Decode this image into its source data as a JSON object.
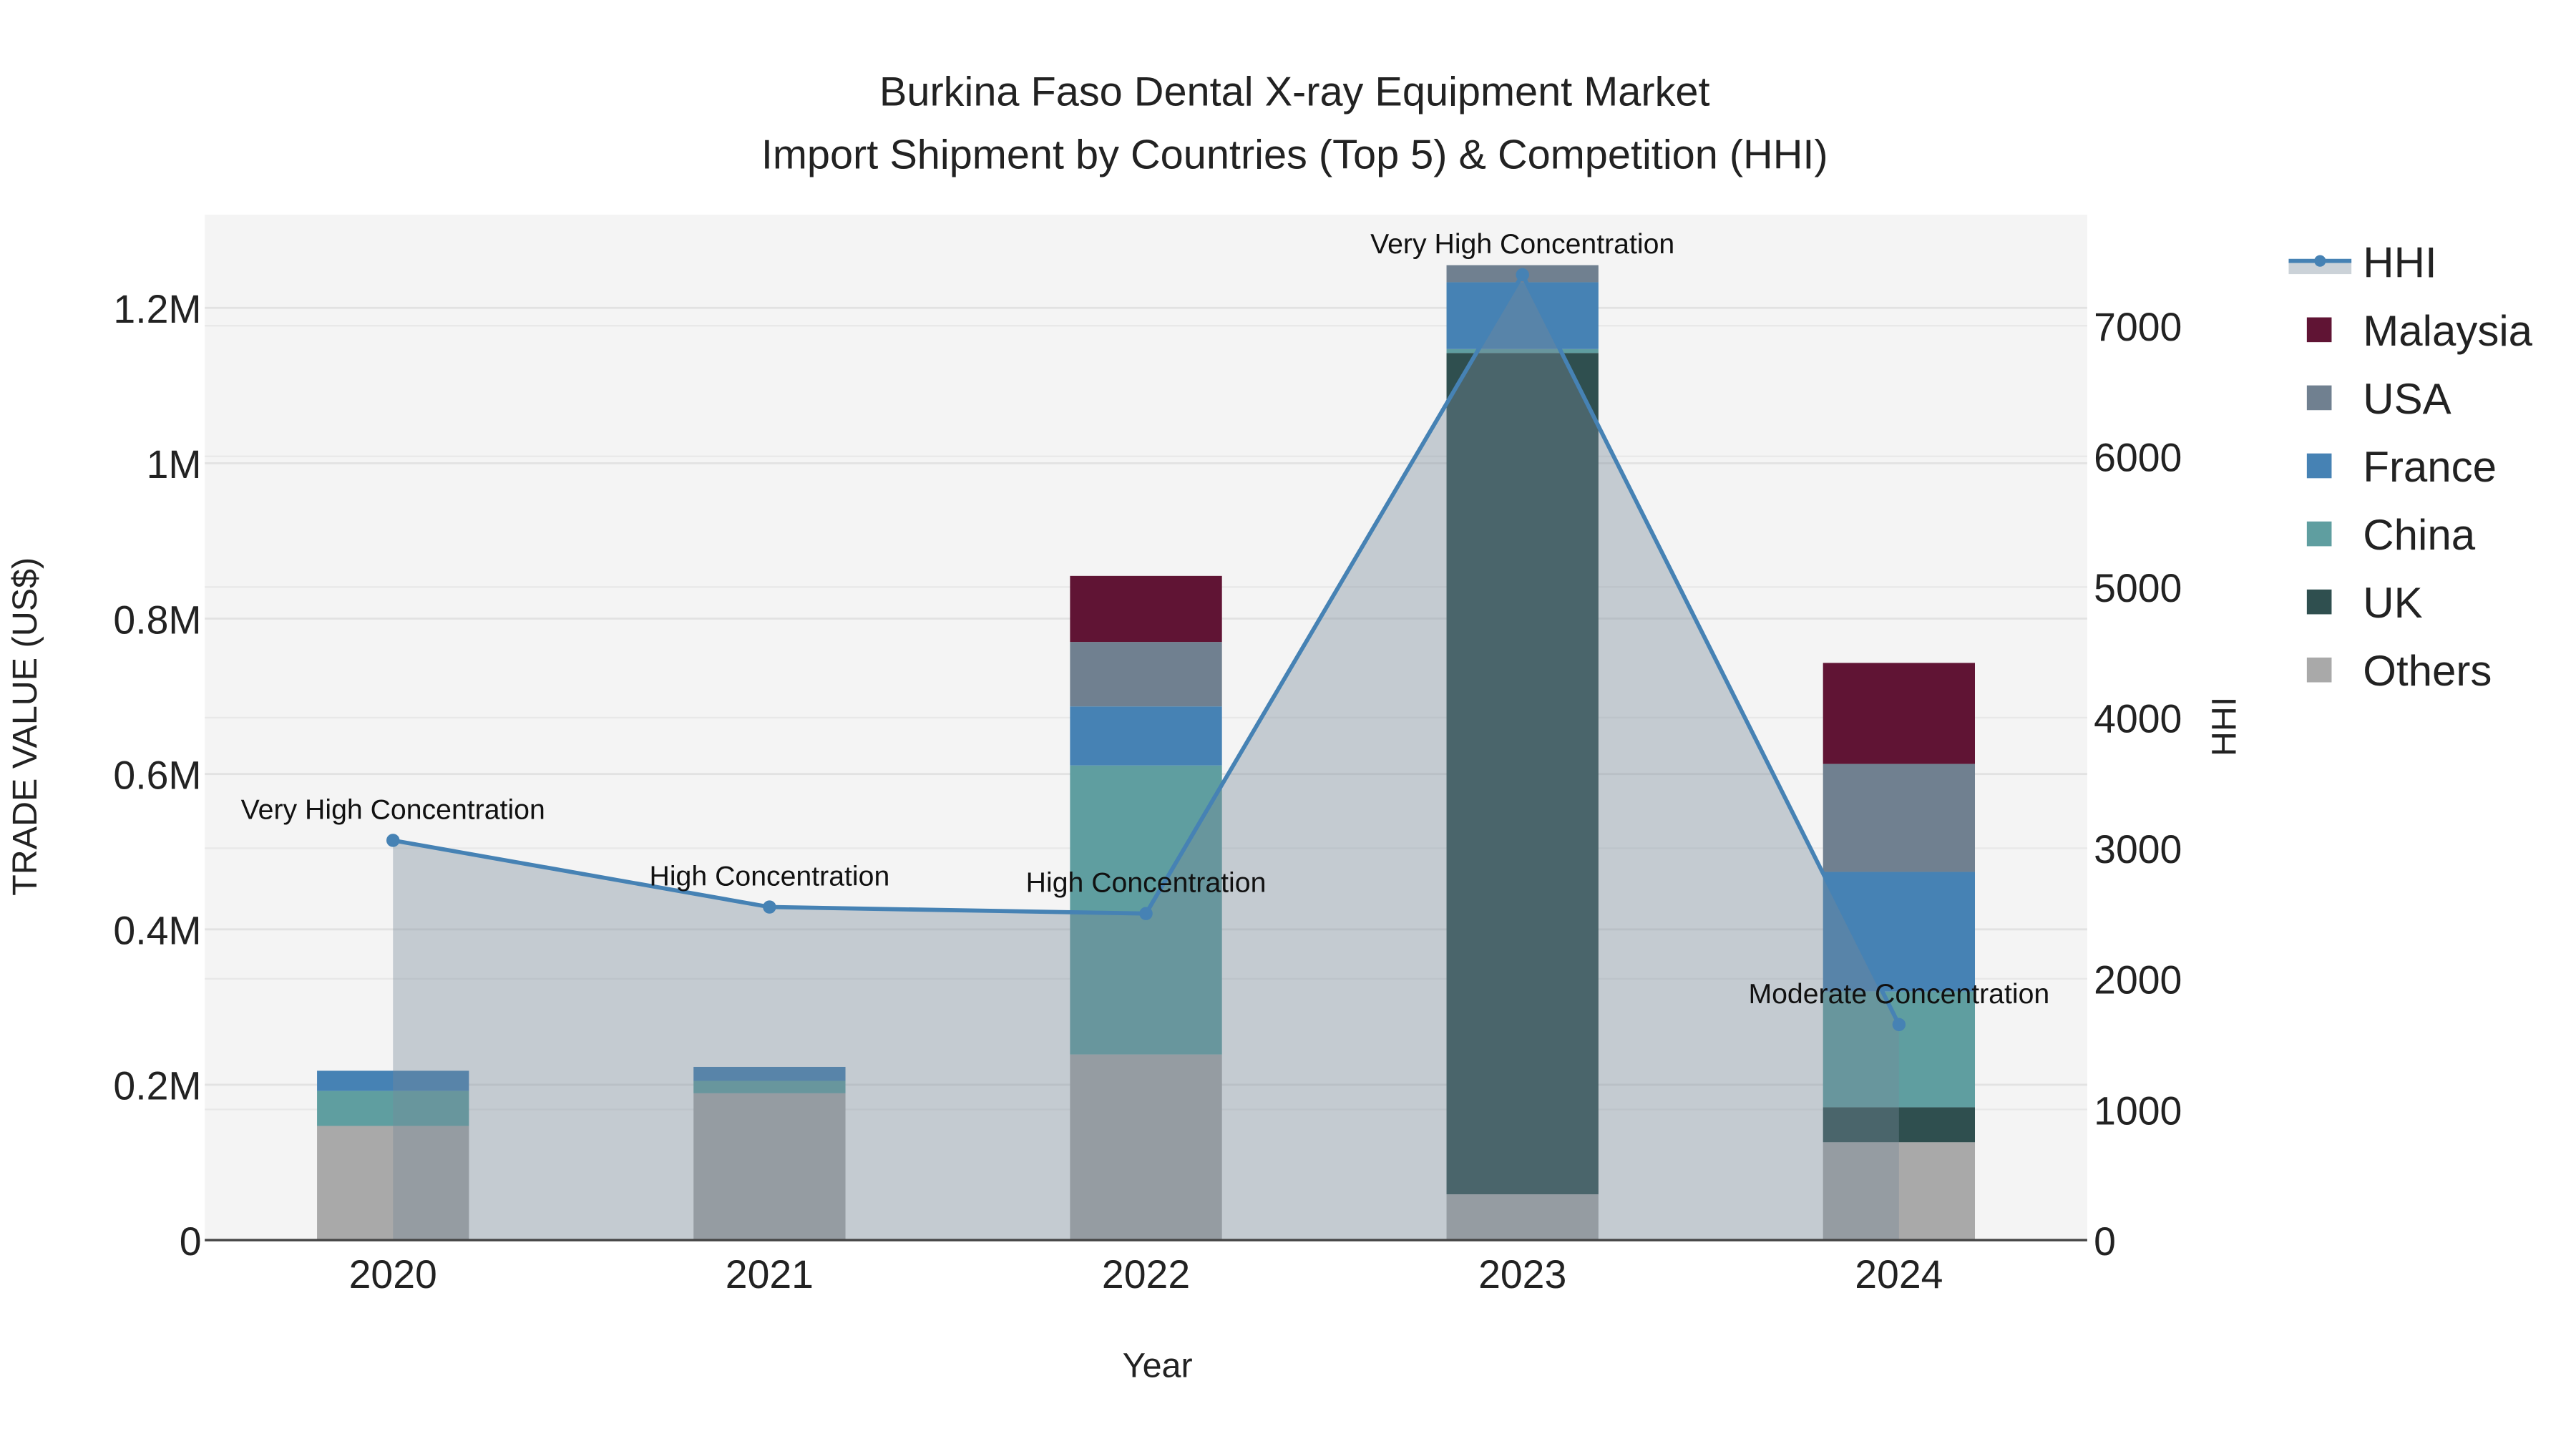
{
  "chart_data": {
    "type": "bar",
    "title": "Burkina Faso Dental X-ray Equipment Market",
    "subtitle": "Import Shipment by Countries (Top 5) & Competition (HHI)",
    "xlabel": "Year",
    "ylabel": "TRADE VALUE (US$)",
    "y2label": "HHI",
    "categories": [
      "2020",
      "2021",
      "2022",
      "2023",
      "2024"
    ],
    "ylim": [
      0,
      1320000
    ],
    "y2lim": [
      0,
      7850
    ],
    "yticks": [
      {
        "v": 0,
        "label": "0"
      },
      {
        "v": 200000,
        "label": "0.2M"
      },
      {
        "v": 400000,
        "label": "0.4M"
      },
      {
        "v": 600000,
        "label": "0.6M"
      },
      {
        "v": 800000,
        "label": "0.8M"
      },
      {
        "v": 1000000,
        "label": "1M"
      },
      {
        "v": 1200000,
        "label": "1.2M"
      }
    ],
    "y2ticks": [
      {
        "v": 0,
        "label": "0"
      },
      {
        "v": 1000,
        "label": "1000"
      },
      {
        "v": 2000,
        "label": "2000"
      },
      {
        "v": 3000,
        "label": "3000"
      },
      {
        "v": 4000,
        "label": "4000"
      },
      {
        "v": 5000,
        "label": "5000"
      },
      {
        "v": 6000,
        "label": "6000"
      },
      {
        "v": 7000,
        "label": "7000"
      }
    ],
    "series": [
      {
        "name": "Others",
        "color": "#a9a9a9",
        "values": [
          147000,
          189000,
          239000,
          59000,
          126000
        ]
      },
      {
        "name": "UK",
        "color": "#2f4f4f",
        "values": [
          0,
          0,
          0,
          1083000,
          45000
        ]
      },
      {
        "name": "China",
        "color": "#5f9ea0",
        "values": [
          45000,
          16000,
          372000,
          5000,
          149000
        ]
      },
      {
        "name": "France",
        "color": "#4682b4",
        "values": [
          26000,
          18000,
          76000,
          86000,
          154000
        ]
      },
      {
        "name": "USA",
        "color": "#708090",
        "values": [
          0,
          0,
          83000,
          22000,
          139000
        ]
      },
      {
        "name": "Malaysia",
        "color": "#601434",
        "values": [
          0,
          0,
          85000,
          0,
          130000
        ]
      }
    ],
    "hhi": {
      "name": "HHI",
      "color": "#4682b4",
      "values": [
        3060,
        2550,
        2500,
        7390,
        1650
      ],
      "annotations": [
        "Very High Concentration",
        "High Concentration",
        "High Concentration",
        "Very High Concentration",
        "Moderate Concentration"
      ]
    },
    "legend": [
      "HHI",
      "Malaysia",
      "USA",
      "France",
      "China",
      "UK",
      "Others"
    ],
    "legend_placement": "right",
    "grid": true
  }
}
